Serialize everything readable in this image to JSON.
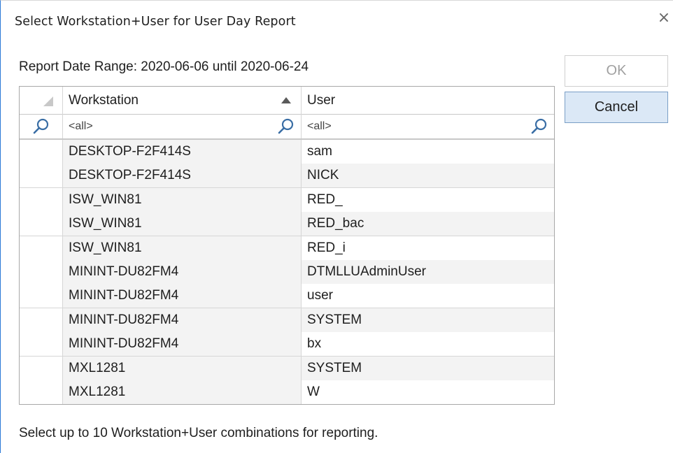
{
  "window": {
    "title": "Select Workstation+User for User Day Report",
    "close_glyph": "×"
  },
  "date_range_label": "Report Date Range: 2020-06-06 until 2020-06-24",
  "buttons": {
    "ok_label": "OK",
    "cancel_label": "Cancel"
  },
  "grid": {
    "columns": {
      "workstation": "Workstation",
      "user": "User"
    },
    "sort": {
      "column": "Workstation",
      "direction": "ascending"
    },
    "filter": {
      "workstation_value": "<all>",
      "user_value": "<all>"
    },
    "rows": [
      {
        "workstation": "DESKTOP-F2F414S",
        "user": "sam"
      },
      {
        "workstation": "DESKTOP-F2F414S",
        "user": "NICK"
      },
      {
        "workstation": "ISW_WIN81",
        "user": "RED_"
      },
      {
        "workstation": "ISW_WIN81",
        "user": "RED_bac"
      },
      {
        "workstation": "ISW_WIN81",
        "user": "RED_i"
      },
      {
        "workstation": "MININT-DU82FM4",
        "user": "DTMLLUAdminUser"
      },
      {
        "workstation": "MININT-DU82FM4",
        "user": "user"
      },
      {
        "workstation": "MININT-DU82FM4",
        "user": "SYSTEM"
      },
      {
        "workstation": "MININT-DU82FM4",
        "user": "bx"
      },
      {
        "workstation": "MXL1281",
        "user": "SYSTEM"
      },
      {
        "workstation": "MXL1281",
        "user": "W"
      }
    ]
  },
  "footer_text": "Select up to 10 Workstation+User combinations for reporting.",
  "icons": {
    "search": "search-icon",
    "close": "close-icon",
    "sort": "sort-ascending-icon"
  },
  "colors": {
    "window_border": "#2b79d7",
    "cancel_button_bg": "#dbe8f6",
    "cancel_button_border": "#7a9ec6",
    "row_alt_bg": "#f3f3f3"
  }
}
